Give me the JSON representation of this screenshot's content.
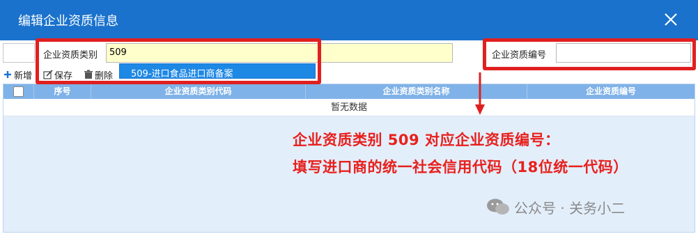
{
  "dialog": {
    "title": "编辑企业资质信息",
    "colors": {
      "titlebar": "#1a72cc",
      "annotation": "#e02020"
    }
  },
  "form": {
    "category_label": "企业资质类别",
    "category_value": "509",
    "number_label": "企业资质编号",
    "number_value": ""
  },
  "dropdown": {
    "options": [
      "509-进口食品进口商备案"
    ]
  },
  "toolbar": {
    "add_label": "新增",
    "save_label": "保存",
    "delete_label": "删除"
  },
  "grid": {
    "columns": [
      "序号",
      "企业资质类别代码",
      "企业资质类别名称",
      "企业资质编号"
    ],
    "empty_text": "暂无数据"
  },
  "annotation": {
    "line1": "企业资质类别 509 对应企业资质编号：",
    "line2": "填写进口商的统一社会信用代码（18位统一代码）"
  },
  "watermark": {
    "text": "公众号 · 关务小二",
    "icon": "wechat-icon"
  }
}
